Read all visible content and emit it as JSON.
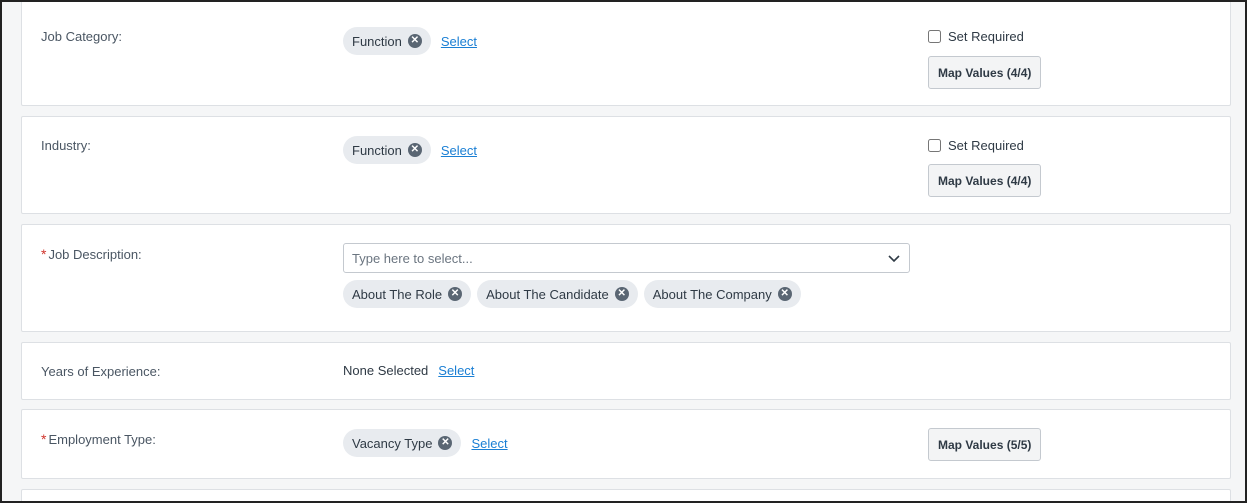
{
  "rows": {
    "job_category": {
      "label": "Job Category:",
      "chips": [
        "Function"
      ],
      "select_link": "Select",
      "set_required": "Set Required",
      "map_button": "Map Values (4/4)"
    },
    "industry": {
      "label": "Industry:",
      "chips": [
        "Function"
      ],
      "select_link": "Select",
      "set_required": "Set Required",
      "map_button": "Map Values (4/4)"
    },
    "job_description": {
      "label": "Job Description:",
      "required_mark": "*",
      "placeholder": "Type here to select...",
      "chips": [
        "About The Role",
        "About The Candidate",
        "About The Company"
      ]
    },
    "years_experience": {
      "label": "Years of Experience:",
      "value": "None Selected",
      "select_link": "Select"
    },
    "employment_type": {
      "label": "Employment Type:",
      "required_mark": "*",
      "chips": [
        "Vacancy Type"
      ],
      "select_link": "Select",
      "map_button": "Map Values (5/5)"
    }
  },
  "icons": {
    "chip_remove": "close-circle-icon",
    "dropdown": "chevron-down-icon"
  },
  "colors": {
    "link": "#1a7fd4",
    "required": "#d0342c",
    "chip_bg": "#e8ebef"
  }
}
